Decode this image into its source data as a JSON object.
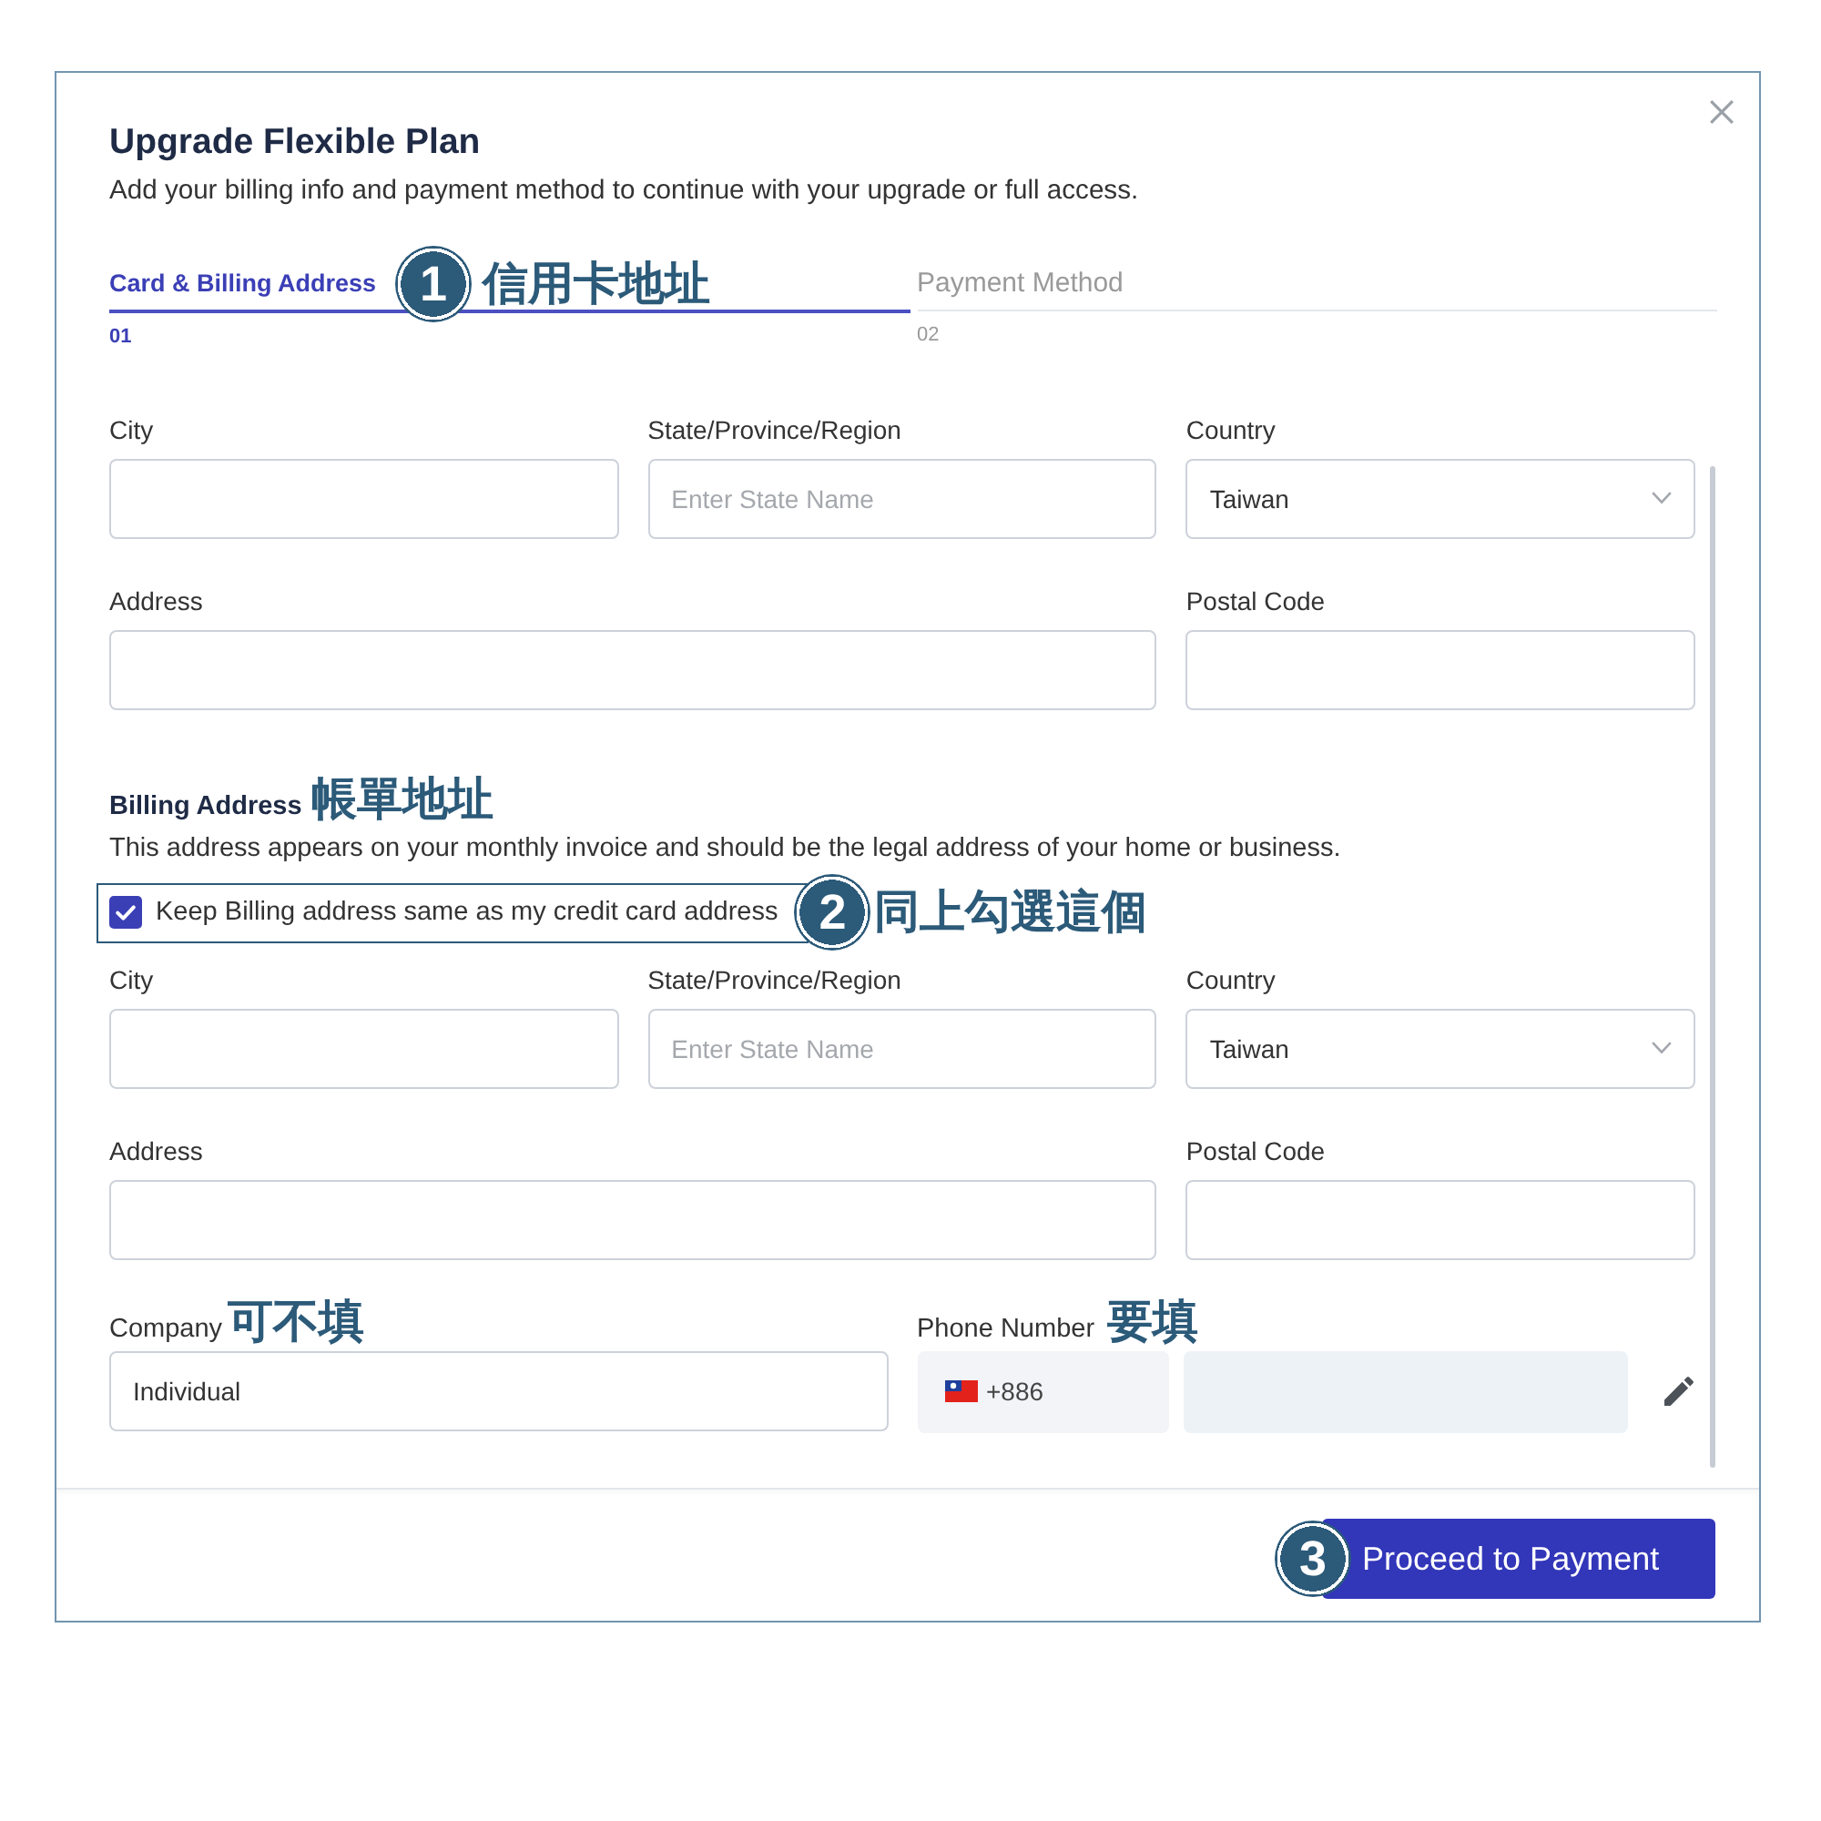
{
  "dialog": {
    "title": "Upgrade Flexible Plan",
    "subtitle": "Add your billing info and payment method to continue with your upgrade or full access."
  },
  "steps": [
    {
      "label": "Card & Billing Address",
      "number": "01",
      "selected": true,
      "note": {
        "badge": "1",
        "text": "信用卡地址"
      }
    },
    {
      "label": "Payment Method",
      "number": "02",
      "selected": false
    }
  ],
  "card_address": {
    "city": {
      "label": "City",
      "kind": "text"
    },
    "state": {
      "label": "State/Province/Region",
      "kind": "text",
      "placeholder": "Enter State Name"
    },
    "country": {
      "label": "Country",
      "kind": "select",
      "value": "Taiwan"
    },
    "address": {
      "label": "Address",
      "kind": "text"
    },
    "postal_code": {
      "label": "Postal Code",
      "kind": "text"
    }
  },
  "billing_address": {
    "heading": "Billing Address",
    "heading_note": "帳單地址",
    "description": "This address appears on your monthly invoice and should be the legal address of your home or business.",
    "same_as_card": {
      "label": "Keep Billing address same as my credit card address",
      "checked": true,
      "note": {
        "badge": "2",
        "text": "同上勾選這個"
      }
    },
    "city": {
      "label": "City",
      "kind": "text"
    },
    "state": {
      "label": "State/Province/Region",
      "kind": "text",
      "placeholder": "Enter State Name"
    },
    "country": {
      "label": "Country",
      "kind": "select",
      "value": "Taiwan"
    },
    "address": {
      "label": "Address",
      "kind": "text"
    },
    "postal_code": {
      "label": "Postal Code",
      "kind": "text"
    }
  },
  "company": {
    "label": "Company",
    "note": "可不填",
    "value": "Individual"
  },
  "phone": {
    "label": "Phone Number",
    "note": "要填",
    "country_code": "+886"
  },
  "footer": {
    "button": "Proceed to Payment",
    "note": {
      "badge": "3"
    }
  }
}
